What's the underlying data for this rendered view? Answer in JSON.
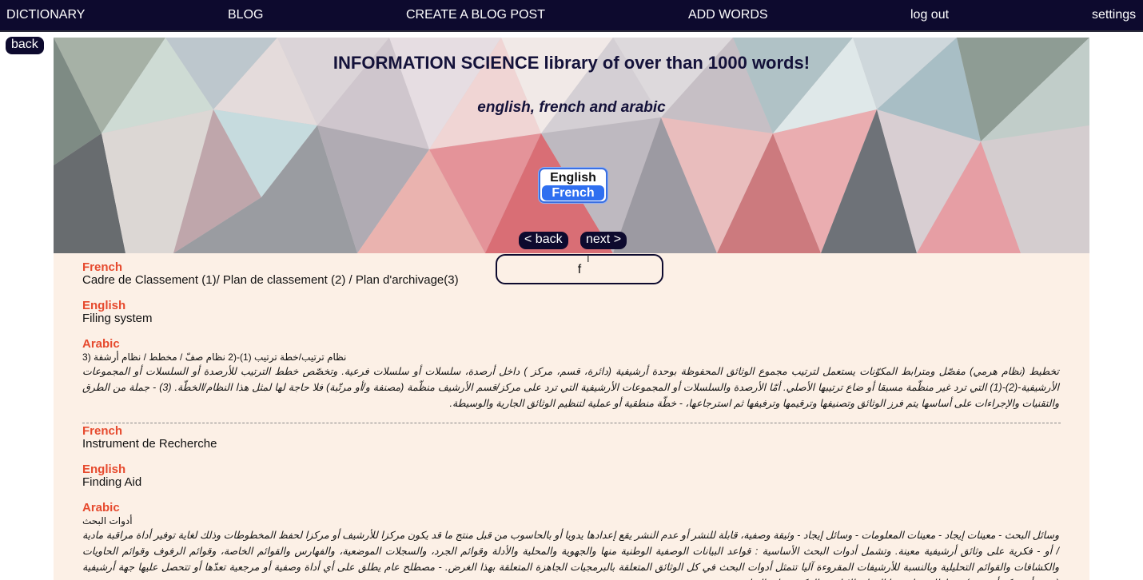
{
  "nav": {
    "dictionary": "DICTIONARY",
    "blog": "BLOG",
    "create_post": "CREATE A BLOG POST",
    "add_words": "ADD WORDS",
    "logout": "log out",
    "settings": "settings"
  },
  "back_label": "back",
  "hero": {
    "title": "INFORMATION SCIENCE library of over than 1000 words!",
    "subtitle": "english, french and arabic"
  },
  "language_select": {
    "options": [
      "English",
      "French"
    ],
    "selected": "French"
  },
  "pager": {
    "back": "< back",
    "next": "next >"
  },
  "search": {
    "value": "f"
  },
  "labels": {
    "french": "French",
    "english": "English",
    "arabic": "Arabic"
  },
  "entries": [
    {
      "french": "Cadre de Classement (1)/ Plan de classement (2) / Plan d'archivage(3)",
      "english": "Filing system",
      "arabic_term": "نظام ترتيب/خطة ترتيب (1)-(2 نظام صفّ / مخطط / نظام أرشفة (3",
      "arabic_def": "تخطيط (نظام هرمي) مفصّل ومترابط المكوّنات يستعمل لترتيب مجموع الوثائق المحفوظة بوحدة أرشيفية (دائرة، قسم، مركز ) داخل أرصدة، سلسلات أو سلسلات فرعية. وتخصّص خطط الترتيب للأرصدة أو السلسلات أو المجموعات الأرشيفية-(2)-(1) التي ترد غير منظّمة مسبقا أو ضاع ترتيبها الأصلي. أمّا الأرصدة والسلسلات أو المجموعات الأرشيفية التي ترد على مركز/قسم الأرشيف منظّمة (مصنفة و/أو مرتّبة) فلا حاجة لها لمثل هذا النظام/الخطّة. (3) - جملة من الطرق والتقنيات والإجراءات على أساسها يتم فرز الوثائق وتصنيفها وترقيمها وترفيفها ثم استرجاعها، - خطّة منطقية أو عملية لتنظيم الوثائق الجارية والوسيطة."
    },
    {
      "french": "Instrument de Recherche",
      "english": "Finding Aid",
      "arabic_term": "أدوات البحث",
      "arabic_def": "وسائل البحث - معينات إيجاد - معينات المعلومات - وسائل إيجاد - وثيقة وصفية، قابلة للنشر أو عدم النشر يقع إعدادها يدويا أو بالحاسوب من قبل منتج ما قد يكون مركزا للأرشيف أو مركزا لحفظ المخطوطات وذلك لغاية توفير أداة مراقبة مادية / أو - فكرية على وثائق أرشيفية معينة. وتشمل أدوات البحث الأساسية : قواعد البيانات الوصفية الوطنية منها والجهوية والمحلية والأدلة وقوائم الجرد، والسجلات الموضعية، والفهارس والقوائم الخاصة، وقوائم الرفوف وقوائم الحاويات والكشافات والقوائم التحليلية وبالنسبة للأرشيفات المقروءة آليا تتمثل أدوات البحث في كل الوثائق المتعلقة بالبرمجيات الجاهزة المتعلقة بهذا الغرض. - مصطلح عام يطلق على أي أداة وصفية أو مرجعية تعدّها أو تتحصل عليها جهة أرشيفية (قسم أو مركز أرشيف) في إطار ممارستها الرقابة الإدارية والفكرية على الوثائق."
    }
  ]
}
